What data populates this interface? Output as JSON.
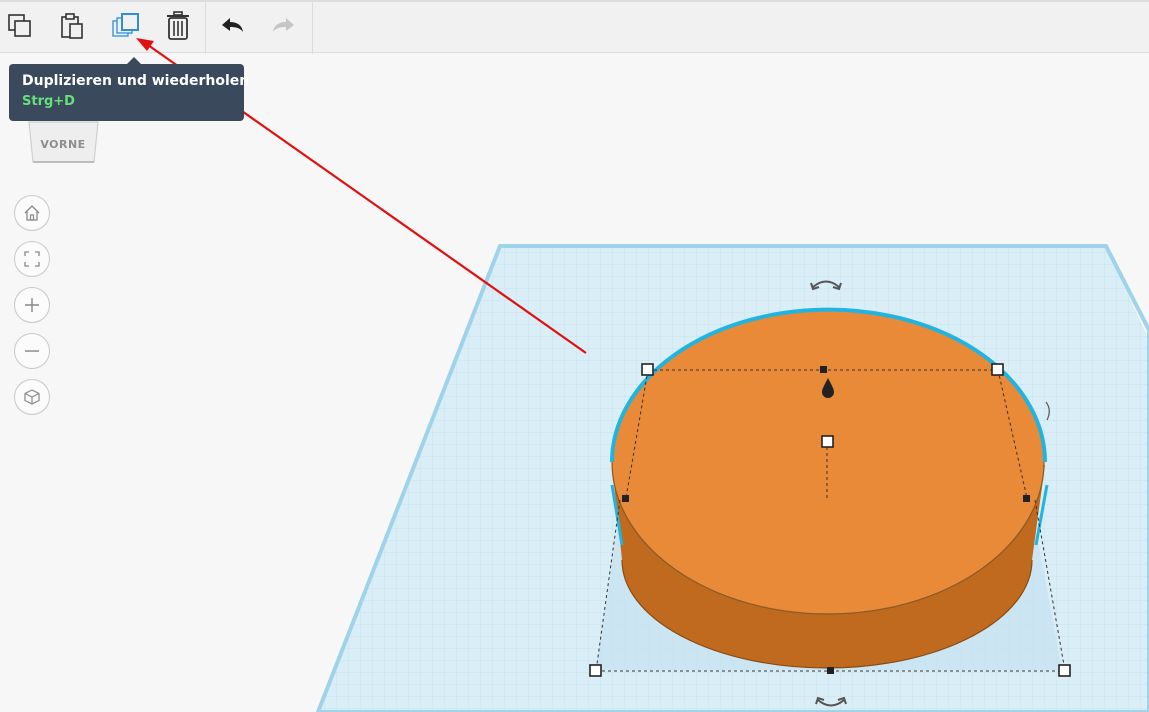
{
  "toolbar": {
    "buttons": [
      {
        "name": "copy-button",
        "icon": "copy-icon",
        "active": false,
        "enabled": true
      },
      {
        "name": "paste-button",
        "icon": "paste-icon",
        "active": false,
        "enabled": true
      },
      {
        "name": "duplicate-repeat-button",
        "icon": "duplicate-icon",
        "active": true,
        "enabled": true
      },
      {
        "name": "delete-button",
        "icon": "trash-icon",
        "active": false,
        "enabled": true
      },
      {
        "name": "undo-button",
        "icon": "undo-arrow-icon",
        "active": false,
        "enabled": true
      },
      {
        "name": "redo-button",
        "icon": "redo-arrow-icon",
        "active": false,
        "enabled": false
      }
    ]
  },
  "tooltip": {
    "title": "Duplizieren und wiederholen",
    "shortcut": "Strg+D"
  },
  "viewcube": {
    "label": "VORNE"
  },
  "nav_controls": [
    {
      "name": "home-view-button",
      "icon": "home-icon"
    },
    {
      "name": "fit-all-button",
      "icon": "fit-frame-icon"
    },
    {
      "name": "zoom-in-button",
      "icon": "plus-icon"
    },
    {
      "name": "zoom-out-button",
      "icon": "minus-icon"
    },
    {
      "name": "perspective-button",
      "icon": "cube-icon"
    }
  ],
  "colors": {
    "shape_top": "#e88a37",
    "shape_side": "#c96e20",
    "shape_outline": "#22b4e0",
    "grid_fill": "#d6ecf5",
    "grid_line": "#b9d9e7",
    "annotation": "#e01010",
    "tooltip_bg": "#3a4a5c",
    "shortcut": "#66e07a",
    "active_icon": "#2e8fd6"
  }
}
